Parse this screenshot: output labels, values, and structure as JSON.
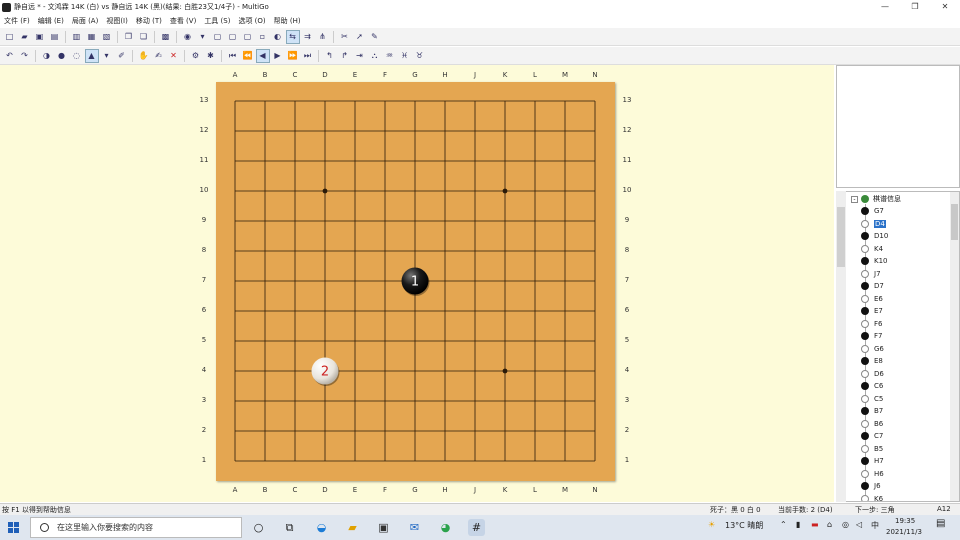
{
  "window": {
    "title": "静自远 * - 文鸿霖 14K (白) vs 静自远 14K (黑)(结果: 白胜23又1/4子) - MultiGo",
    "controls": [
      "—",
      "❐",
      "✕"
    ]
  },
  "menu": [
    "文件 (F)",
    "编辑 (E)",
    "局面 (A)",
    "视图(I)",
    "移动 (T)",
    "查看 (V)",
    "工具 (S)",
    "选项 (O)",
    "帮助 (H)"
  ],
  "board": {
    "size": 13,
    "columns": [
      "A",
      "B",
      "C",
      "D",
      "E",
      "F",
      "G",
      "H",
      "J",
      "K",
      "L",
      "M",
      "N"
    ],
    "rows": [
      "13",
      "12",
      "11",
      "10",
      "9",
      "8",
      "7",
      "6",
      "5",
      "4",
      "3",
      "2",
      "1"
    ],
    "star_points": [
      "D10",
      "K10",
      "K4"
    ],
    "stones": [
      {
        "pos": "G7",
        "color": "black",
        "number": "1",
        "number_color": "#ffffff"
      },
      {
        "pos": "D4",
        "color": "white",
        "number": "2",
        "number_color": "#cc2222"
      }
    ],
    "colors": {
      "wood": "#e4a651",
      "line": "#2a1a08",
      "background": "#fdfbd9"
    }
  },
  "tree": {
    "root_label": "棋谱信息",
    "moves": [
      {
        "label": "G7",
        "color": "B"
      },
      {
        "label": "D4",
        "color": "W",
        "selected": true
      },
      {
        "label": "D10",
        "color": "B"
      },
      {
        "label": "K4",
        "color": "W"
      },
      {
        "label": "K10",
        "color": "B"
      },
      {
        "label": "J7",
        "color": "W"
      },
      {
        "label": "D7",
        "color": "B"
      },
      {
        "label": "E6",
        "color": "W"
      },
      {
        "label": "E7",
        "color": "B"
      },
      {
        "label": "F6",
        "color": "W"
      },
      {
        "label": "F7",
        "color": "B"
      },
      {
        "label": "G6",
        "color": "W"
      },
      {
        "label": "E8",
        "color": "B"
      },
      {
        "label": "D6",
        "color": "W"
      },
      {
        "label": "C6",
        "color": "B"
      },
      {
        "label": "C5",
        "color": "W"
      },
      {
        "label": "B7",
        "color": "B"
      },
      {
        "label": "B6",
        "color": "W"
      },
      {
        "label": "C7",
        "color": "B"
      },
      {
        "label": "B5",
        "color": "W"
      },
      {
        "label": "H7",
        "color": "B"
      },
      {
        "label": "H6",
        "color": "W"
      },
      {
        "label": "J6",
        "color": "B"
      },
      {
        "label": "K6",
        "color": "W"
      }
    ]
  },
  "status": {
    "help": "按 F1 以得到帮助信息",
    "captures": "死子：黑 0 白 0",
    "current": "当前手数: 2 (D4)",
    "next": "下一步: 三角",
    "coord": "A12"
  },
  "taskbar": {
    "search_placeholder": "在这里输入你要搜索的内容",
    "weather": "13°C 晴朗",
    "ime": "中",
    "time": "19:35",
    "date": "2021/11/3"
  }
}
